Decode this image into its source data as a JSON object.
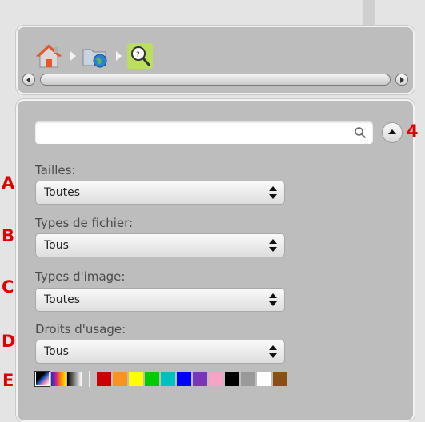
{
  "nav": {
    "icons": [
      "home-icon",
      "folder-globe-icon",
      "search-folder-icon"
    ],
    "separator": "chevron-right-icon"
  },
  "search": {
    "value": "",
    "placeholder": ""
  },
  "callouts": {
    "a": "A",
    "b": "B",
    "c": "C",
    "d": "D",
    "e": "E",
    "four": "4"
  },
  "filters": {
    "sizes": {
      "label": "Tailles:",
      "value": "Toutes"
    },
    "file_types": {
      "label": "Types de fichier:",
      "value": "Tous"
    },
    "image_types": {
      "label": "Types d'image:",
      "value": "Toutes"
    },
    "usage_rights": {
      "label": "Droits d'usage:",
      "value": "Tous"
    }
  },
  "colors": {
    "modes": [
      "full-color",
      "color",
      "black-and-white"
    ],
    "swatches": [
      "#cc0000",
      "#f7931e",
      "#ffff00",
      "#00cc00",
      "#00c0c0",
      "#0000ff",
      "#7a36b8",
      "#f7a3c8",
      "#000000",
      "#999999",
      "#ffffff",
      "#8b4f13"
    ]
  }
}
